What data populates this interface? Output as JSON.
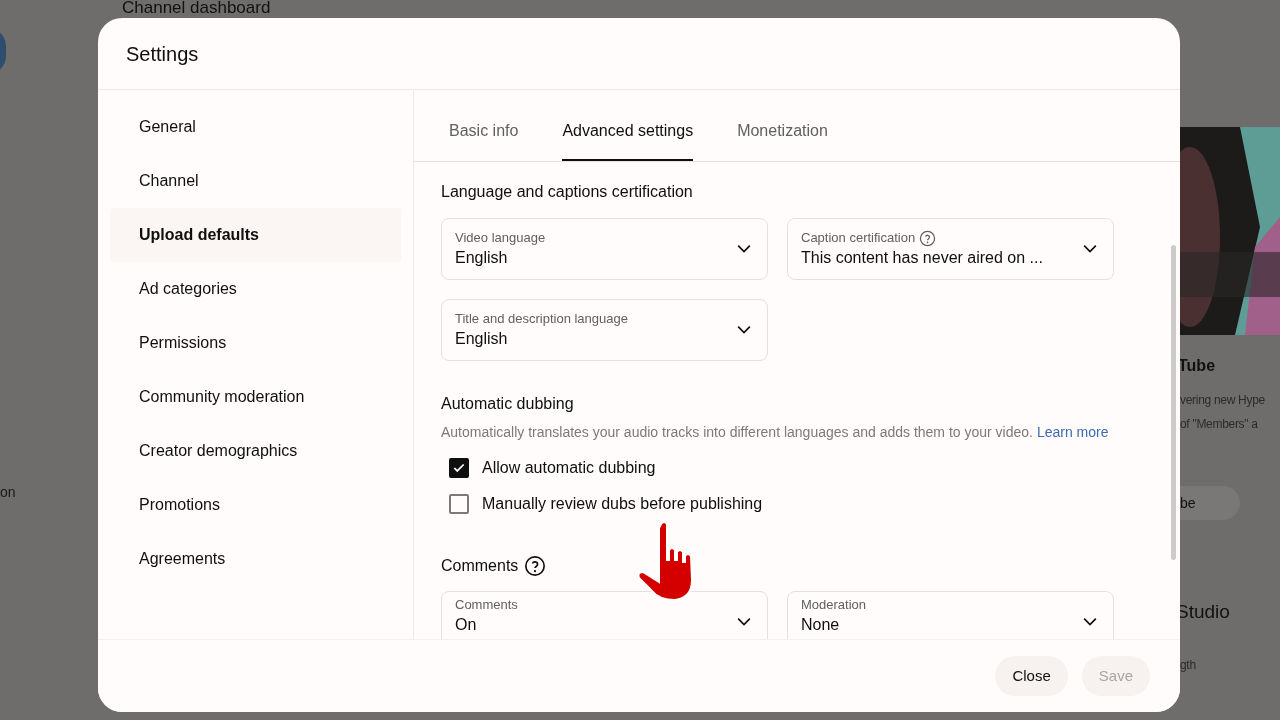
{
  "background": {
    "heading": "Channel dashboard",
    "left_text": "on",
    "right_texts": [
      {
        "kind": "title",
        "text": "Tube"
      },
      {
        "kind": "body",
        "text": "vering new Hype"
      },
      {
        "kind": "body",
        "text": "of \"Members\" a"
      },
      {
        "kind": "chip",
        "text": "be"
      },
      {
        "kind": "heading",
        "text": "Studio"
      },
      {
        "kind": "body",
        "text": "gth"
      }
    ]
  },
  "dialog": {
    "title": "Settings",
    "nav": [
      {
        "label": "General",
        "selected": false
      },
      {
        "label": "Channel",
        "selected": false
      },
      {
        "label": "Upload defaults",
        "selected": true
      },
      {
        "label": "Ad categories",
        "selected": false
      },
      {
        "label": "Permissions",
        "selected": false
      },
      {
        "label": "Community moderation",
        "selected": false
      },
      {
        "label": "Creator demographics",
        "selected": false
      },
      {
        "label": "Promotions",
        "selected": false
      },
      {
        "label": "Agreements",
        "selected": false
      }
    ],
    "tabs": [
      {
        "label": "Basic info",
        "selected": false
      },
      {
        "label": "Advanced settings",
        "selected": true
      },
      {
        "label": "Monetization",
        "selected": false
      }
    ],
    "language_section": {
      "title": "Language and captions certification",
      "fields": [
        {
          "label": "Video language",
          "value": "English",
          "help": false
        },
        {
          "label": "Caption certification",
          "value": "This content has never aired on ...",
          "help": true
        },
        {
          "label": "Title and description language",
          "value": "English",
          "help": false
        }
      ]
    },
    "dubbing_section": {
      "title": "Automatic dubbing",
      "description": "Automatically translates your audio tracks into different languages and adds them to your video.",
      "link": "Learn more",
      "options": [
        {
          "label": "Allow automatic dubbing",
          "checked": true
        },
        {
          "label": "Manually review dubs before publishing",
          "checked": false
        }
      ]
    },
    "comments_section": {
      "title": "Comments",
      "fields": [
        {
          "label": "Comments",
          "value": "On"
        },
        {
          "label": "Moderation",
          "value": "None"
        }
      ]
    },
    "buttons": [
      {
        "label": "Close",
        "disabled": false
      },
      {
        "label": "Save",
        "disabled": true
      }
    ]
  }
}
